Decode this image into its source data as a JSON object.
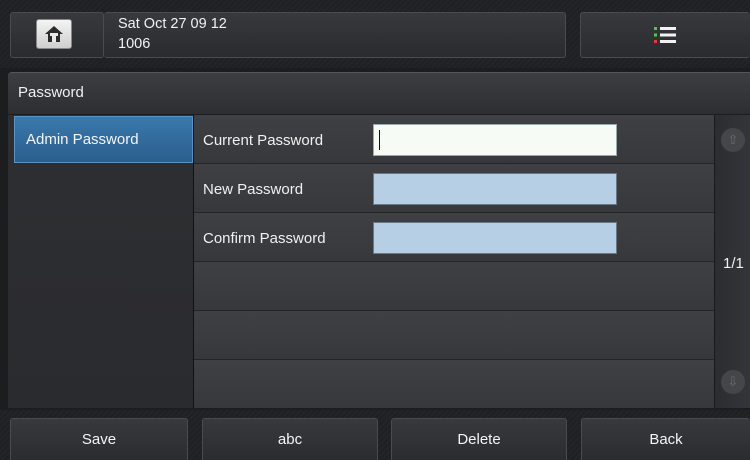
{
  "status": {
    "datetime": "Sat Oct 27 09 12",
    "account": "1006",
    "home_icon": "home-icon",
    "menu_icon": "menu-list-icon"
  },
  "title": "Password",
  "nav": {
    "items": [
      {
        "label": "Admin Password",
        "selected": true
      }
    ]
  },
  "form": {
    "current_password_label": "Current Password",
    "current_password_value": "",
    "new_password_label": "New Password",
    "new_password_value": "",
    "confirm_password_label": "Confirm Password",
    "confirm_password_value": ""
  },
  "pager": {
    "indicator": "1/1"
  },
  "softkeys": {
    "save": "Save",
    "input_mode": "abc",
    "delete": "Delete",
    "back": "Back"
  },
  "colors": {
    "selected_nav": "#2f6a9a",
    "input_field": "#b6cfe5",
    "active_field": "#f7fbf5"
  }
}
